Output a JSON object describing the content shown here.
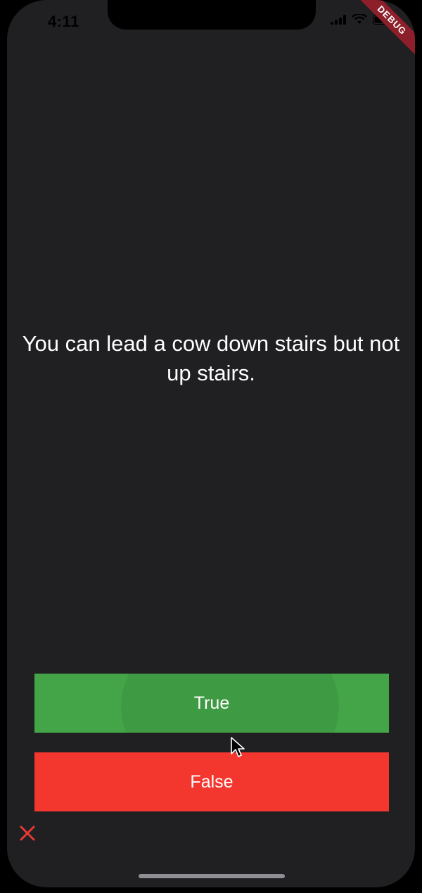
{
  "status_bar": {
    "time": "4:11",
    "icons": [
      "cellular-icon",
      "wifi-icon",
      "battery-icon"
    ]
  },
  "debug_banner": "DEBUG",
  "question": "You can lead a cow down stairs but not up stairs.",
  "buttons": {
    "true_label": "True",
    "false_label": "False"
  },
  "score_keeper": [
    "close-icon"
  ],
  "colors": {
    "background": "#201f22",
    "true_button": "#43a548",
    "false_button": "#f3372f",
    "wrong_mark": "#e53935"
  }
}
